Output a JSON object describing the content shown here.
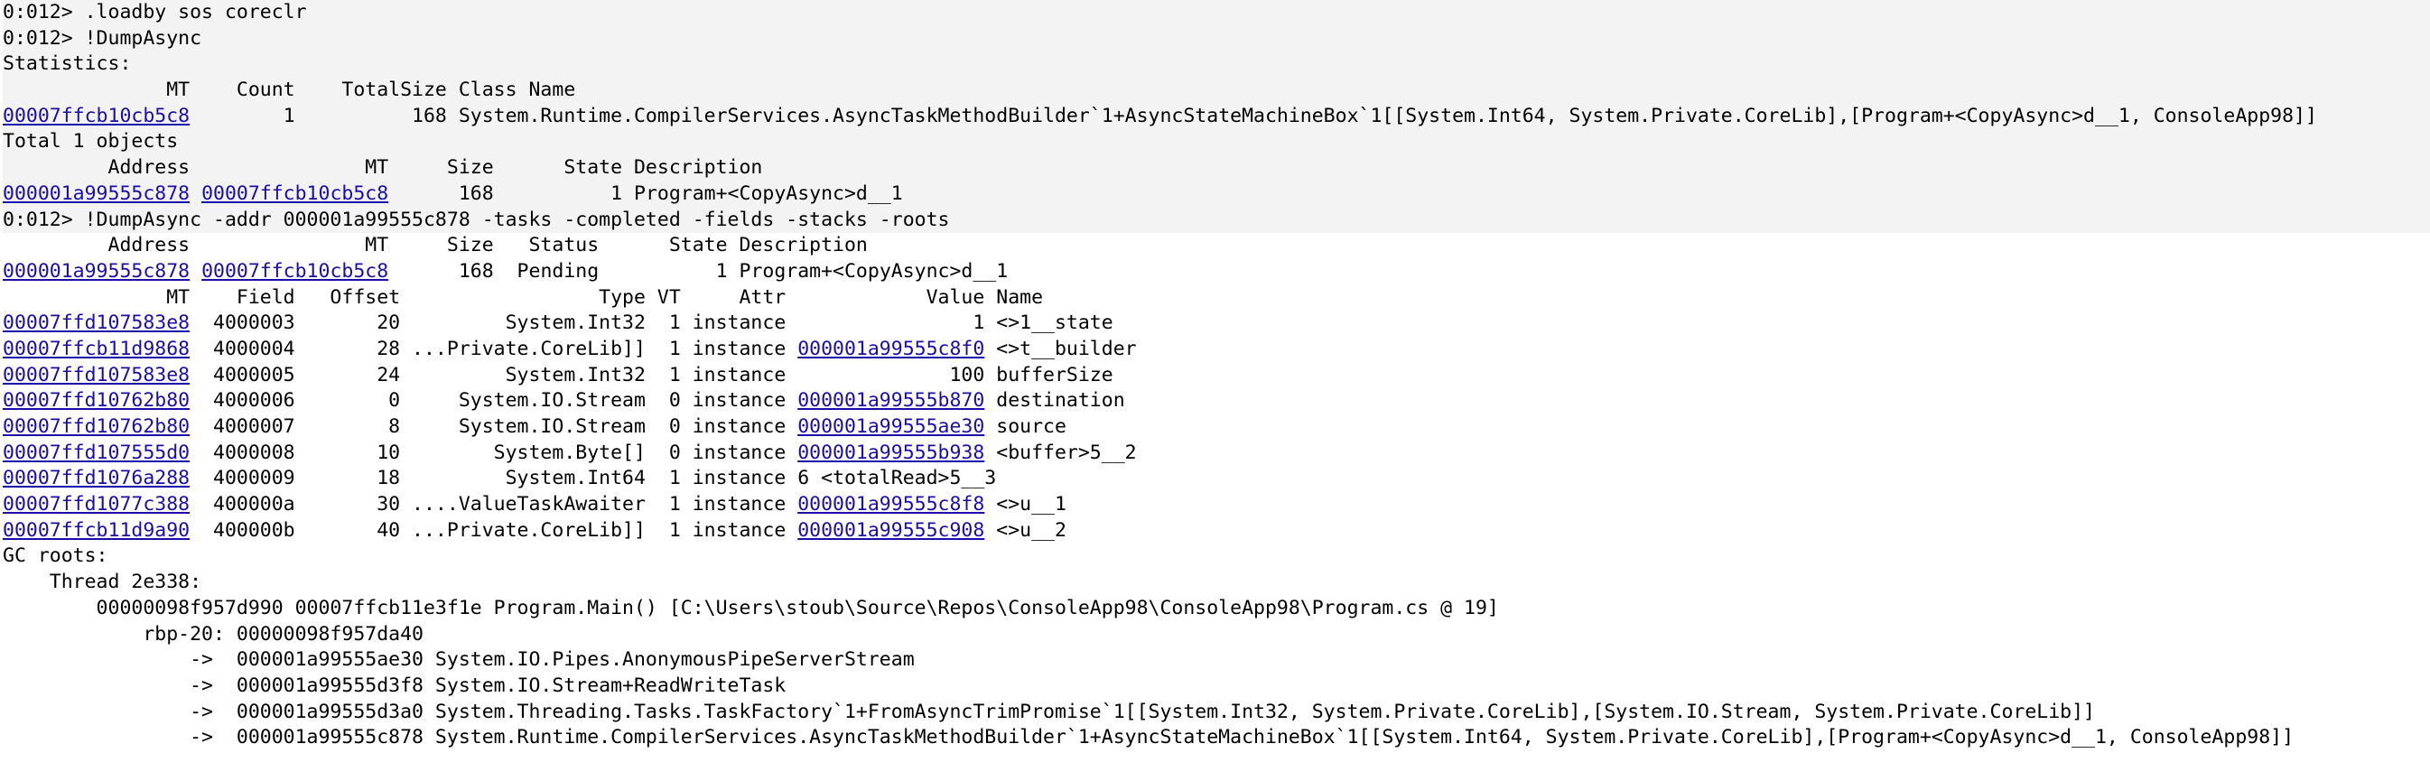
{
  "colors": {
    "link": "#1a0dab",
    "text": "#000000",
    "background": "#ffffff",
    "command_band": "#f3f3f3"
  },
  "lines": [
    {
      "k": "cmd",
      "t": [
        {
          "s": "0:012> .loadby sos coreclr"
        }
      ]
    },
    {
      "k": "cmd",
      "t": [
        {
          "s": "0:012> !DumpAsync"
        }
      ]
    },
    {
      "k": "blk",
      "t": [
        {
          "s": "Statistics:"
        }
      ]
    },
    {
      "k": "blk",
      "t": [
        {
          "s": "              MT    Count    TotalSize Class Name"
        }
      ]
    },
    {
      "k": "blk",
      "t": [
        {
          "s": "00007ffcb10cb5c8",
          "l": 1
        },
        {
          "s": "        1          168 System.Runtime.CompilerServices.AsyncTaskMethodBuilder`1+AsyncStateMachineBox`1[[System.Int64, System.Private.CoreLib],[Program+<CopyAsync>d__1, ConsoleApp98]]"
        }
      ]
    },
    {
      "k": "blk",
      "t": [
        {
          "s": "Total 1 objects"
        }
      ]
    },
    {
      "k": "blk",
      "t": [
        {
          "s": "         Address               MT     Size      State Description"
        }
      ]
    },
    {
      "k": "blk",
      "t": [
        {
          "s": "000001a99555c878",
          "l": 1
        },
        {
          "s": " "
        },
        {
          "s": "00007ffcb10cb5c8",
          "l": 1
        },
        {
          "s": "      168          1 Program+<CopyAsync>d__1"
        }
      ]
    },
    {
      "k": "cmd",
      "t": [
        {
          "s": "0:012> !DumpAsync -addr 000001a99555c878 -tasks -completed -fields -stacks -roots"
        }
      ]
    },
    {
      "k": "",
      "t": [
        {
          "s": "         Address               MT     Size   Status      State Description"
        }
      ]
    },
    {
      "k": "",
      "t": [
        {
          "s": "000001a99555c878",
          "l": 1
        },
        {
          "s": " "
        },
        {
          "s": "00007ffcb10cb5c8",
          "l": 1
        },
        {
          "s": "      168  Pending          1 Program+<CopyAsync>d__1"
        }
      ]
    },
    {
      "k": "",
      "t": [
        {
          "s": "              MT    Field   Offset                 Type VT     Attr            Value Name"
        }
      ]
    },
    {
      "k": "",
      "t": [
        {
          "s": "00007ffd107583e8",
          "l": 1
        },
        {
          "s": "  4000003       20         System.Int32  1 instance                1 <>1__state"
        }
      ]
    },
    {
      "k": "",
      "t": [
        {
          "s": "00007ffcb11d9868",
          "l": 1
        },
        {
          "s": "  4000004       28 ...Private.CoreLib]]  1 instance "
        },
        {
          "s": "000001a99555c8f0",
          "l": 1
        },
        {
          "s": " <>t__builder"
        }
      ]
    },
    {
      "k": "",
      "t": [
        {
          "s": "00007ffd107583e8",
          "l": 1
        },
        {
          "s": "  4000005       24         System.Int32  1 instance              100 bufferSize"
        }
      ]
    },
    {
      "k": "",
      "t": [
        {
          "s": "00007ffd10762b80",
          "l": 1
        },
        {
          "s": "  4000006        0     System.IO.Stream  0 instance "
        },
        {
          "s": "000001a99555b870",
          "l": 1
        },
        {
          "s": " destination"
        }
      ]
    },
    {
      "k": "",
      "t": [
        {
          "s": "00007ffd10762b80",
          "l": 1
        },
        {
          "s": "  4000007        8     System.IO.Stream  0 instance "
        },
        {
          "s": "000001a99555ae30",
          "l": 1
        },
        {
          "s": " source"
        }
      ]
    },
    {
      "k": "",
      "t": [
        {
          "s": "00007ffd107555d0",
          "l": 1
        },
        {
          "s": "  4000008       10        System.Byte[]  0 instance "
        },
        {
          "s": "000001a99555b938",
          "l": 1
        },
        {
          "s": " <buffer>5__2"
        }
      ]
    },
    {
      "k": "",
      "t": [
        {
          "s": "00007ffd1076a288",
          "l": 1
        },
        {
          "s": "  4000009       18         System.Int64  1 instance 6 <totalRead>5__3"
        }
      ]
    },
    {
      "k": "",
      "t": [
        {
          "s": "00007ffd1077c388",
          "l": 1
        },
        {
          "s": "  400000a       30 ....ValueTaskAwaiter  1 instance "
        },
        {
          "s": "000001a99555c8f8",
          "l": 1
        },
        {
          "s": " <>u__1"
        }
      ]
    },
    {
      "k": "",
      "t": [
        {
          "s": "00007ffcb11d9a90",
          "l": 1
        },
        {
          "s": "  400000b       40 ...Private.CoreLib]]  1 instance "
        },
        {
          "s": "000001a99555c908",
          "l": 1
        },
        {
          "s": " <>u__2"
        }
      ]
    },
    {
      "k": "",
      "t": [
        {
          "s": "GC roots:"
        }
      ]
    },
    {
      "k": "",
      "t": [
        {
          "s": "    Thread 2e338:"
        }
      ]
    },
    {
      "k": "",
      "t": [
        {
          "s": "        00000098f957d990 00007ffcb11e3f1e Program.Main() [C:\\Users\\stoub\\Source\\Repos\\ConsoleApp98\\ConsoleApp98\\Program.cs @ 19]"
        }
      ]
    },
    {
      "k": "",
      "t": [
        {
          "s": "            rbp-20: 00000098f957da40"
        }
      ]
    },
    {
      "k": "",
      "t": [
        {
          "s": "                ->  000001a99555ae30 System.IO.Pipes.AnonymousPipeServerStream"
        }
      ]
    },
    {
      "k": "",
      "t": [
        {
          "s": "                ->  000001a99555d3f8 System.IO.Stream+ReadWriteTask"
        }
      ]
    },
    {
      "k": "",
      "t": [
        {
          "s": "                ->  000001a99555d3a0 System.Threading.Tasks.TaskFactory`1+FromAsyncTrimPromise`1[[System.Int32, System.Private.CoreLib],[System.IO.Stream, System.Private.CoreLib]]"
        }
      ]
    },
    {
      "k": "",
      "t": [
        {
          "s": "                ->  000001a99555c878 System.Runtime.CompilerServices.AsyncTaskMethodBuilder`1+AsyncStateMachineBox`1[[System.Int64, System.Private.CoreLib],[Program+<CopyAsync>d__1, ConsoleApp98]]"
        }
      ]
    }
  ]
}
